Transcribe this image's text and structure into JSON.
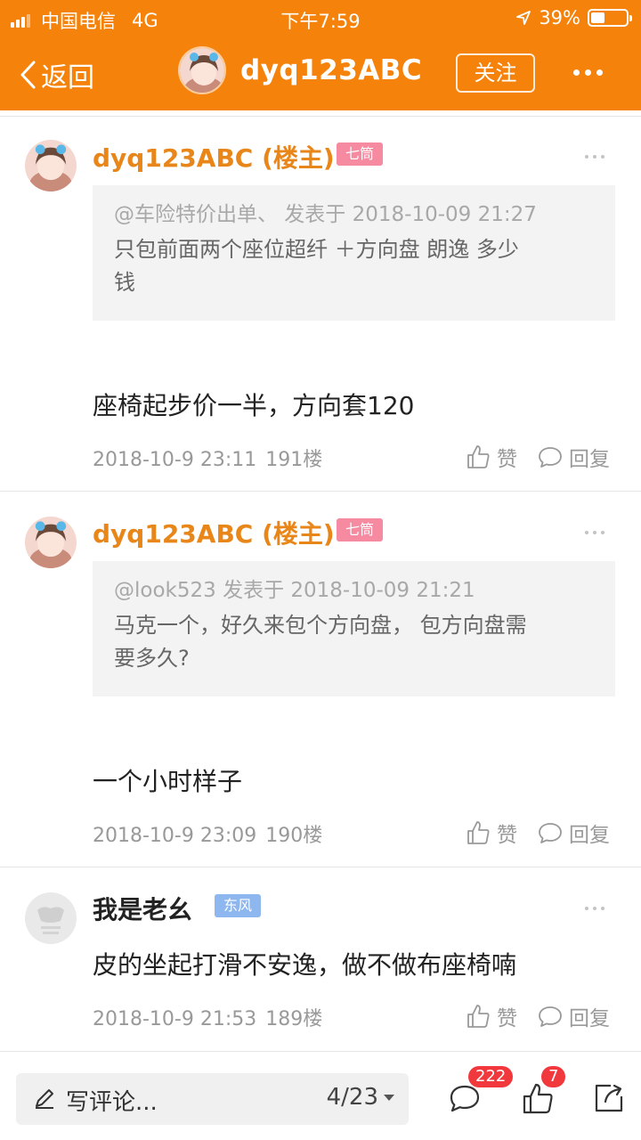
{
  "status_bar": {
    "carrier": "中国电信",
    "network": "4G",
    "time": "下午7:59",
    "battery": "39%",
    "battery_level": 0.39
  },
  "nav": {
    "back_label": "返回",
    "title": "dyq123ABC",
    "follow_label": "关注"
  },
  "posts": [
    {
      "username": "dyq123ABC (楼主)",
      "badge": "七筒",
      "quote_header": "@车险特价出单、 发表于 2018-10-09 21:27",
      "quote_lines": [
        "只包前面两个座位超纤 ＋方向盘 朗逸 多少",
        "钱"
      ],
      "text": "座椅起步价一半，方向套120",
      "date": "2018-10-9 23:11",
      "floor": "191楼",
      "like_label": "赞",
      "reply_label": "回复"
    },
    {
      "username": "dyq123ABC (楼主)",
      "badge": "七筒",
      "quote_header": "@look523 发表于 2018-10-09 21:21",
      "quote_lines": [
        "马克一个，好久来包个方向盘， 包方向盘需",
        "要多久?"
      ],
      "text": "一个小时样子",
      "date": "2018-10-9 23:09",
      "floor": "190楼",
      "like_label": "赞",
      "reply_label": "回复"
    },
    {
      "username": "我是老幺",
      "badge": "东风",
      "text": "皮的坐起打滑不安逸，做不做布座椅喃",
      "date": "2018-10-9 21:53",
      "floor": "189楼",
      "like_label": "赞",
      "reply_label": "回复"
    }
  ],
  "bottom_bar": {
    "comment_placeholder": "写评论...",
    "page": "4/23",
    "comment_count": "222",
    "like_count": "7"
  },
  "colors": {
    "brand": "#f5820a",
    "owner_name": "#e8861a",
    "badge_pink": "#f58aa0",
    "badge_blue": "#8eb6ef",
    "notify_red": "#f0383d"
  },
  "icons": [
    "back-chevron-icon",
    "more-icon",
    "like-icon",
    "reply-icon",
    "pencil-icon",
    "comment-icon",
    "thumb-icon",
    "share-icon",
    "location-arrow-icon"
  ]
}
